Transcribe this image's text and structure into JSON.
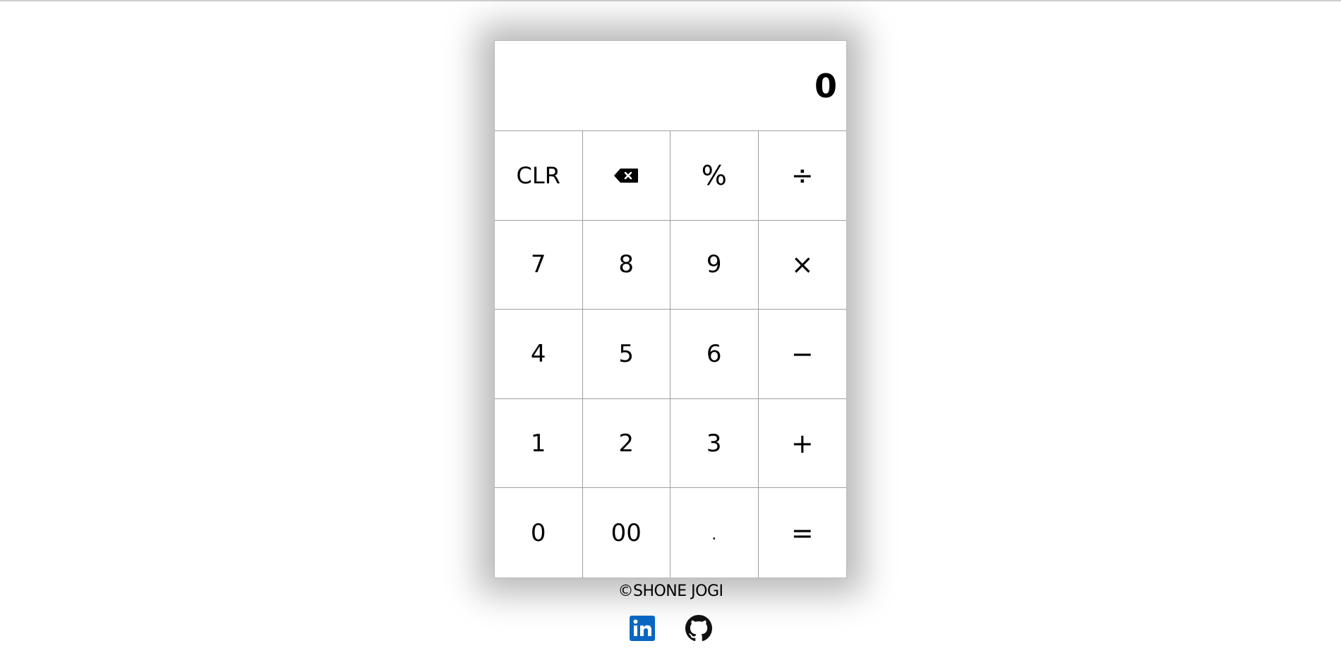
{
  "calculator": {
    "display_value": "0",
    "keys": [
      {
        "label": "CLR",
        "name": "clear-button"
      },
      {
        "label": "",
        "name": "backspace-button",
        "icon": "backspace-icon"
      },
      {
        "label": "%",
        "name": "percent-button"
      },
      {
        "label": "÷",
        "name": "divide-button"
      },
      {
        "label": "7",
        "name": "digit-7-button"
      },
      {
        "label": "8",
        "name": "digit-8-button"
      },
      {
        "label": "9",
        "name": "digit-9-button"
      },
      {
        "label": "×",
        "name": "multiply-button"
      },
      {
        "label": "4",
        "name": "digit-4-button"
      },
      {
        "label": "5",
        "name": "digit-5-button"
      },
      {
        "label": "6",
        "name": "digit-6-button"
      },
      {
        "label": "−",
        "name": "subtract-button"
      },
      {
        "label": "1",
        "name": "digit-1-button"
      },
      {
        "label": "2",
        "name": "digit-2-button"
      },
      {
        "label": "3",
        "name": "digit-3-button"
      },
      {
        "label": "+",
        "name": "add-button"
      },
      {
        "label": "0",
        "name": "digit-0-button"
      },
      {
        "label": "00",
        "name": "double-zero-button"
      },
      {
        "label": ".",
        "name": "decimal-button"
      },
      {
        "label": "=",
        "name": "equals-button"
      }
    ]
  },
  "footer": {
    "copyright": "©SHONE JOGI"
  },
  "social": {
    "linkedin_icon": "linkedin-icon",
    "github_icon": "github-icon",
    "linkedin_color": "#0a66c2"
  }
}
